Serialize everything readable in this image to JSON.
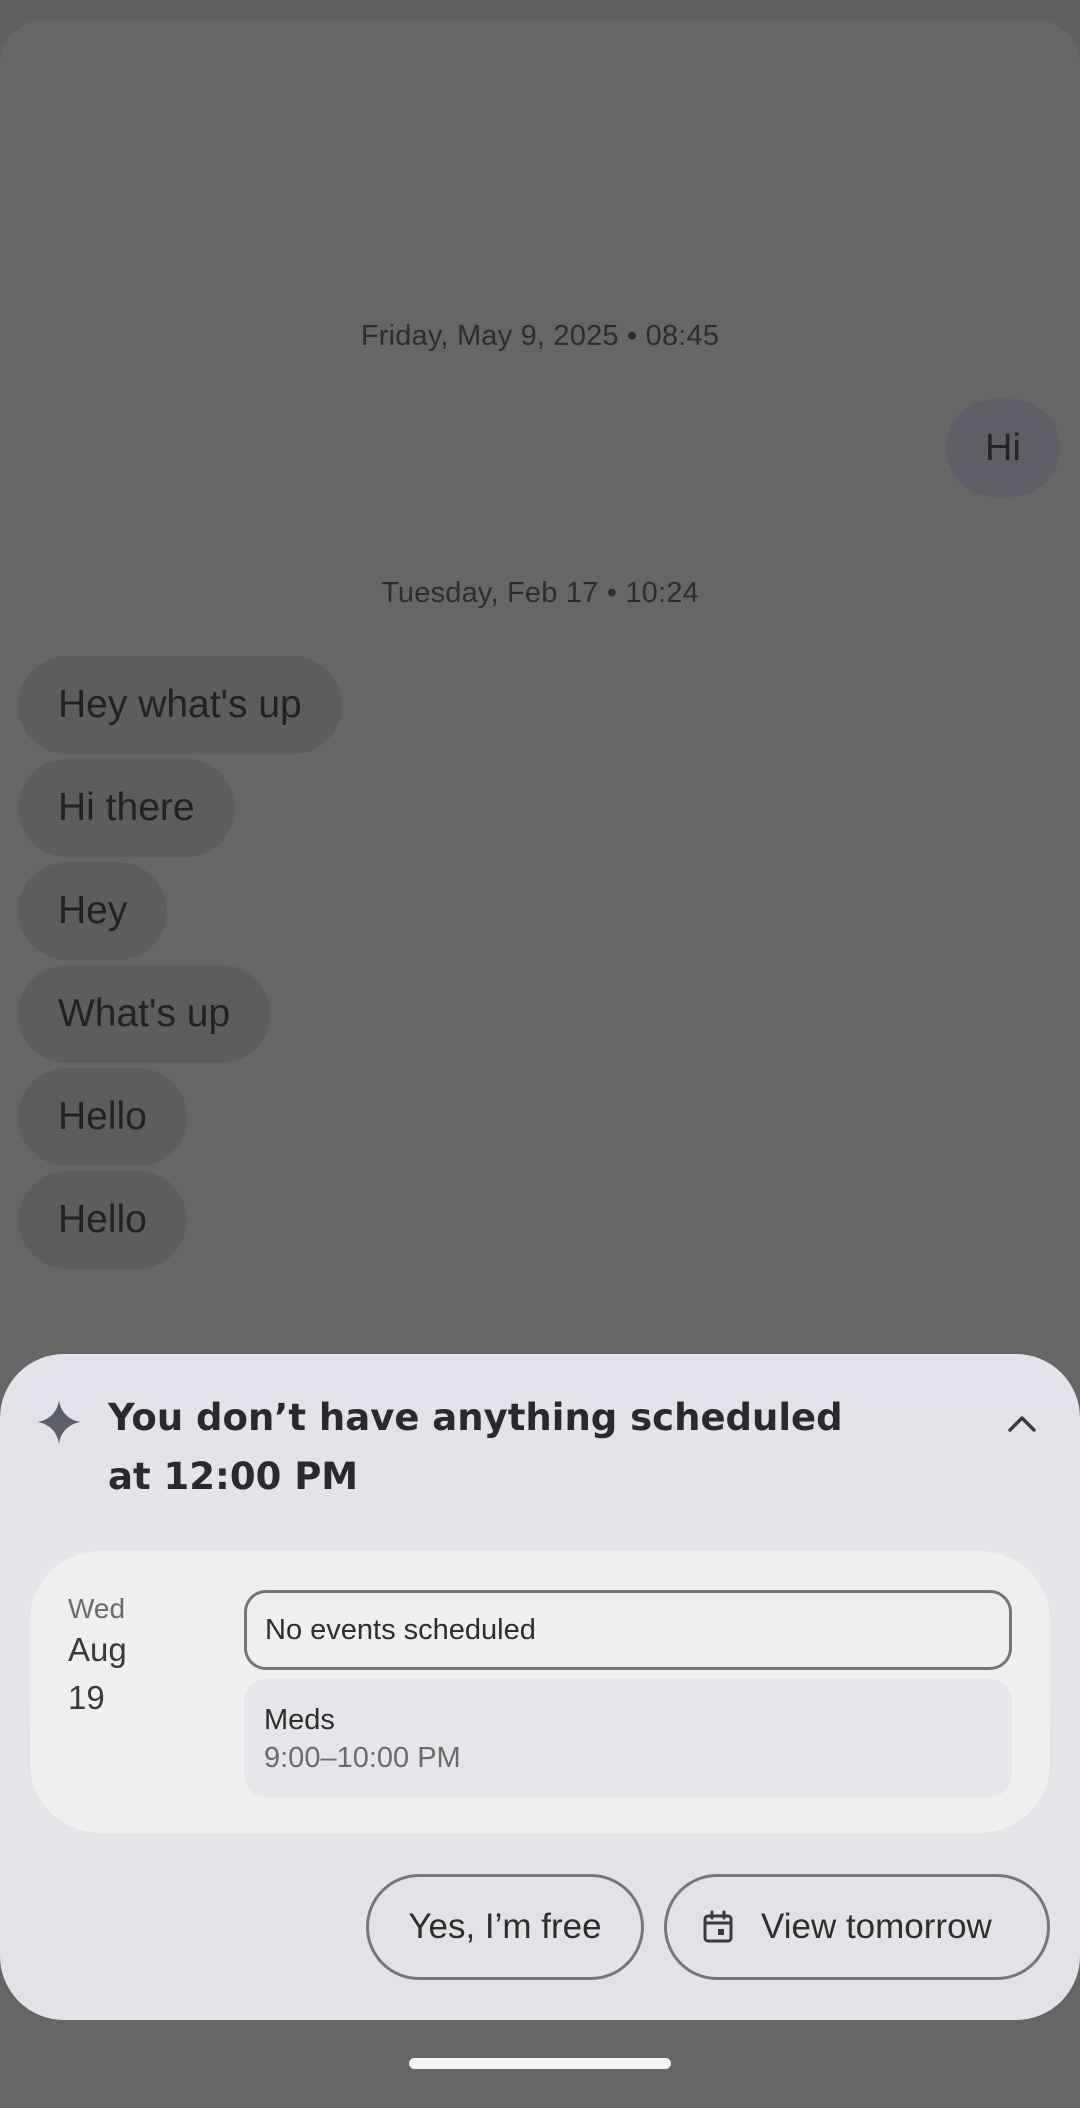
{
  "chat": {
    "timestamp_1": "Friday, May 9, 2025 • 08:45",
    "outgoing_message": "Hi",
    "timestamp_2": "Tuesday, Feb 17 • 10:24",
    "incoming_messages": [
      "Hey what's up",
      "Hi there",
      "Hey",
      "What's up",
      "Hello",
      "Hello"
    ]
  },
  "sheet": {
    "title": "You don’t have anything scheduled at 12:00 PM",
    "icons": {
      "leading": "sparkle-icon",
      "trailing": "chevron-up-icon",
      "calendar": "calendar-icon"
    },
    "calendar_card": {
      "day": "Wed",
      "month": "Aug",
      "date": "19",
      "no_events_label": "No events scheduled",
      "event": {
        "title": "Meds",
        "time": "9:00–10:00 PM"
      }
    },
    "actions": {
      "yes_free": "Yes, I’m free",
      "view_tomorrow": "View tomorrow"
    }
  },
  "colors": {
    "scrim": "#666666",
    "sheet_background": "#e4e2e6",
    "card_background": "#f0eeef",
    "text_primary": "#2a2a2e"
  }
}
